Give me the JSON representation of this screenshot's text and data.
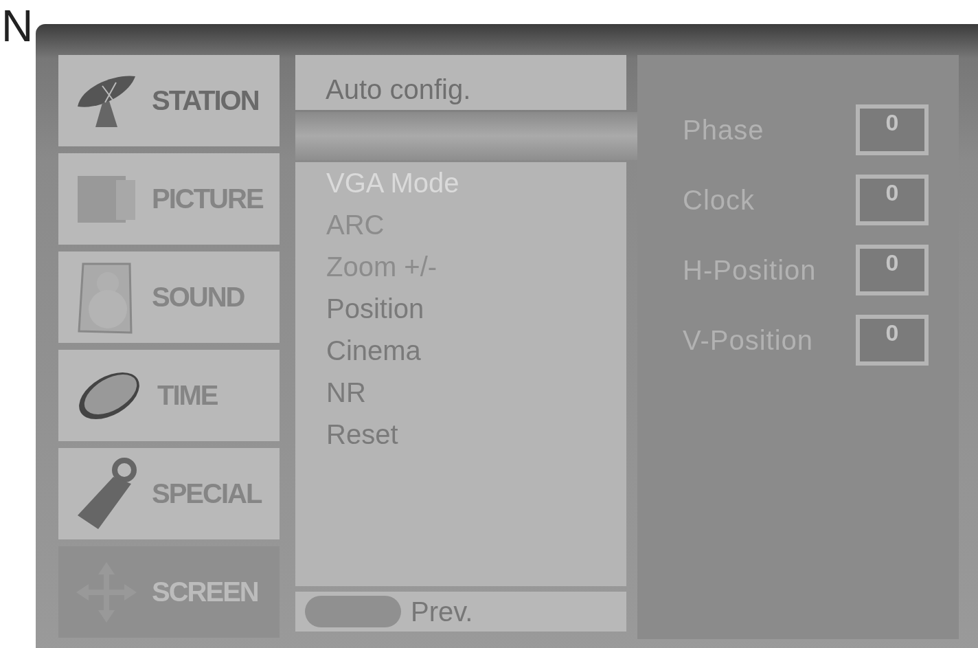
{
  "page_heading": "N",
  "categories": [
    {
      "label": "STATION",
      "selected": false,
      "dimmed": false
    },
    {
      "label": "PICTURE",
      "selected": false,
      "dimmed": true
    },
    {
      "label": "SOUND",
      "selected": false,
      "dimmed": true
    },
    {
      "label": "TIME",
      "selected": false,
      "dimmed": true
    },
    {
      "label": "SPECIAL",
      "selected": false,
      "dimmed": true
    },
    {
      "label": "SCREEN",
      "selected": true,
      "dimmed": false
    }
  ],
  "top_item": "Auto config.",
  "menu_items": [
    {
      "label": "VGA Mode",
      "disabled": false
    },
    {
      "label": "ARC",
      "disabled": true
    },
    {
      "label": "Zoom +/-",
      "disabled": true
    },
    {
      "label": "Position",
      "disabled": false
    },
    {
      "label": "Cinema",
      "disabled": false
    },
    {
      "label": "NR",
      "disabled": false
    },
    {
      "label": "Reset",
      "disabled": false
    }
  ],
  "prev_label": "Prev.",
  "settings": [
    {
      "label": "Phase",
      "value": "0"
    },
    {
      "label": "Clock",
      "value": "0"
    },
    {
      "label": "H-Position",
      "value": "0"
    },
    {
      "label": "V-Position",
      "value": "0"
    }
  ]
}
